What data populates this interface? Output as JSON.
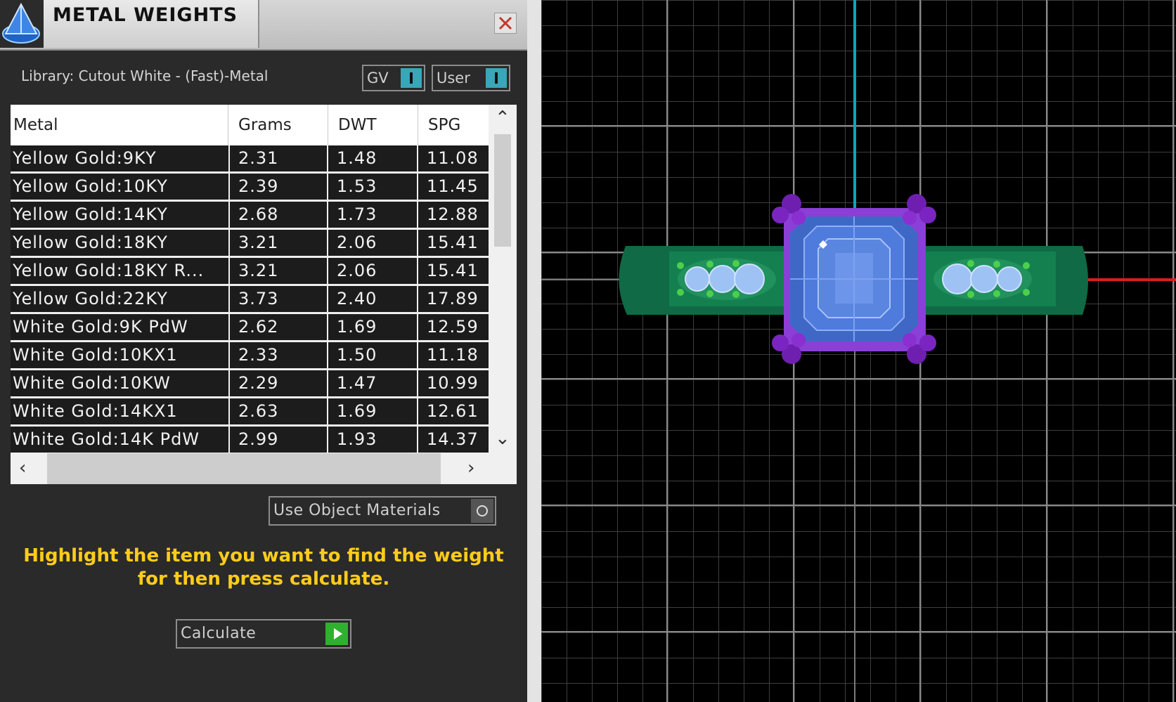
{
  "panel": {
    "title": "METAL WEIGHTS",
    "library_label": "Library: Cutout White - (Fast)-Metal",
    "toggles": [
      {
        "label": "GV"
      },
      {
        "label": "User"
      }
    ],
    "table": {
      "columns": [
        "Metal",
        "Grams",
        "DWT",
        "SPG"
      ],
      "rows": [
        [
          "Yellow Gold:9KY",
          "2.31",
          "1.48",
          "11.08"
        ],
        [
          "Yellow Gold:10KY",
          "2.39",
          "1.53",
          "11.45"
        ],
        [
          "Yellow Gold:14KY",
          "2.68",
          "1.73",
          "12.88"
        ],
        [
          "Yellow Gold:18KY",
          "3.21",
          "2.06",
          "15.41"
        ],
        [
          "Yellow Gold:18KY R...",
          "3.21",
          "2.06",
          "15.41"
        ],
        [
          "Yellow Gold:22KY",
          "3.73",
          "2.40",
          "17.89"
        ],
        [
          "White Gold:9K PdW",
          "2.62",
          "1.69",
          "12.59"
        ],
        [
          "White Gold:10KX1",
          "2.33",
          "1.50",
          "11.18"
        ],
        [
          "White Gold:10KW",
          "2.29",
          "1.47",
          "10.99"
        ],
        [
          "White Gold:14KX1",
          "2.63",
          "1.69",
          "12.61"
        ],
        [
          "White Gold:14K PdW",
          "2.99",
          "1.93",
          "14.37"
        ]
      ]
    },
    "use_object_materials": "Use Object Materials",
    "hint": "Highlight the item you want to find the weight for then press calculate.",
    "calculate_label": "Calculate"
  },
  "icons": {
    "logo": "cone-logo-icon",
    "close": "close-icon",
    "scroll_up": "chevron-up-icon",
    "scroll_down": "chevron-down-icon",
    "scroll_left": "chevron-left-icon",
    "scroll_right": "chevron-right-icon"
  },
  "colors": {
    "hint_text": "#ffcc1a",
    "toggle_accent": "#3aa6b9",
    "calculate_arrow": "#2fb12f",
    "ring_band": "#0f6a45",
    "gem": "#5a86e0",
    "prongs": "#8a2fd0",
    "axis_vertical": "#0aa7b5",
    "axis_horizontal": "#d81e1e"
  }
}
